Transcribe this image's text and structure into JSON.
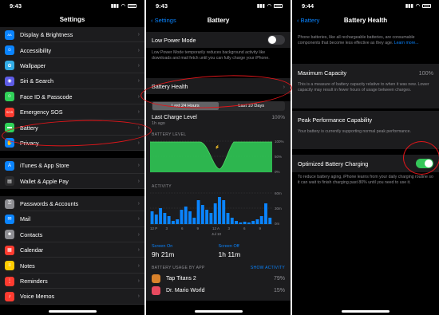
{
  "panel1": {
    "status_time": "9:43",
    "title": "Settings",
    "items": [
      {
        "label": "Display & Brightness",
        "icon": "display-icon",
        "color": "#0a84ff",
        "glyph": "AA"
      },
      {
        "label": "Accessibility",
        "icon": "accessibility-icon",
        "color": "#0a84ff",
        "glyph": "☺"
      },
      {
        "label": "Wallpaper",
        "icon": "wallpaper-icon",
        "color": "#32ade6",
        "glyph": "✿"
      },
      {
        "label": "Siri & Search",
        "icon": "siri-icon",
        "color": "#5e5ce6",
        "glyph": "◉"
      },
      {
        "label": "Face ID & Passcode",
        "icon": "faceid-icon",
        "color": "#30d158",
        "glyph": "☺"
      },
      {
        "label": "Emergency SOS",
        "icon": "sos-icon",
        "color": "#ff3b30",
        "glyph": "SOS"
      },
      {
        "label": "Battery",
        "icon": "battery-icon",
        "color": "#30d158",
        "glyph": "▬"
      },
      {
        "label": "Privacy",
        "icon": "privacy-icon",
        "color": "#0a84ff",
        "glyph": "✋"
      },
      {
        "label": "iTunes & App Store",
        "icon": "appstore-icon",
        "color": "#0a84ff",
        "glyph": "A"
      },
      {
        "label": "Wallet & Apple Pay",
        "icon": "wallet-icon",
        "color": "#2c2c2e",
        "glyph": "▤"
      },
      {
        "label": "Passwords & Accounts",
        "icon": "key-icon",
        "color": "#8e8e93",
        "glyph": "⚿"
      },
      {
        "label": "Mail",
        "icon": "mail-icon",
        "color": "#0a84ff",
        "glyph": "✉"
      },
      {
        "label": "Contacts",
        "icon": "contacts-icon",
        "color": "#8e8e93",
        "glyph": "☻"
      },
      {
        "label": "Calendar",
        "icon": "calendar-icon",
        "color": "#ff3b30",
        "glyph": "▦"
      },
      {
        "label": "Notes",
        "icon": "notes-icon",
        "color": "#ffcc00",
        "glyph": "≡"
      },
      {
        "label": "Reminders",
        "icon": "reminders-icon",
        "color": "#ff3b30",
        "glyph": "⋮"
      },
      {
        "label": "Voice Memos",
        "icon": "voicememo-icon",
        "color": "#ff3b30",
        "glyph": "♪"
      }
    ]
  },
  "panel2": {
    "status_time": "9:43",
    "back_label": "Settings",
    "title": "Battery",
    "low_power_label": "Low Power Mode",
    "low_power_note": "Low Power Mode temporarily reduces background activity like downloads and mail fetch until you can fully charge your iPhone.",
    "battery_health_label": "Battery Health",
    "tab_24h": "Last 24 Hours",
    "tab_10d": "Last 10 Days",
    "last_charge_label": "Last Charge Level",
    "last_charge_time": "1h ago",
    "last_charge_value": "100%",
    "battery_level_label": "BATTERY LEVEL",
    "battery_ticks": [
      "100%",
      "50%",
      "0%"
    ],
    "activity_label": "ACTIVITY",
    "activity_ticks": [
      "60m",
      "30m",
      "0m"
    ],
    "time_ticks": [
      "12 P",
      "3",
      "6",
      "9",
      "12 A",
      "3",
      "6",
      "9"
    ],
    "date_label": "Jul 10",
    "screen_on_label": "Screen On",
    "screen_on_value": "9h 21m",
    "screen_off_label": "Screen Off",
    "screen_off_value": "1h 11m",
    "usage_label": "BATTERY USAGE BY APP",
    "show_activity": "SHOW ACTIVITY",
    "apps": [
      {
        "name": "Tap Titans 2",
        "value": "79%"
      },
      {
        "name": "Dr. Mario World",
        "value": "15%"
      }
    ]
  },
  "panel3": {
    "status_time": "9:44",
    "back_label": "Battery",
    "title": "Battery Health",
    "intro": "Phone batteries, like all rechargeable batteries, are consumable components that become less effective as they age.",
    "learn_more": "Learn more...",
    "max_capacity_label": "Maximum Capacity",
    "max_capacity_value": "100%",
    "max_capacity_note": "This is a measure of battery capacity relative to when it was new. Lower capacity may result in fewer hours of usage between charges.",
    "peak_label": "Peak Performance Capability",
    "peak_note": "Your battery is currently supporting normal peak performance.",
    "optimized_label": "Optimized Battery Charging",
    "optimized_note": "To reduce battery aging, iPhone learns from your daily charging routine so it can wait to finish charging past 80% until you need to use it."
  },
  "colors": {
    "accent": "#0a84ff",
    "green": "#34c759",
    "annotation": "#e0161a"
  }
}
